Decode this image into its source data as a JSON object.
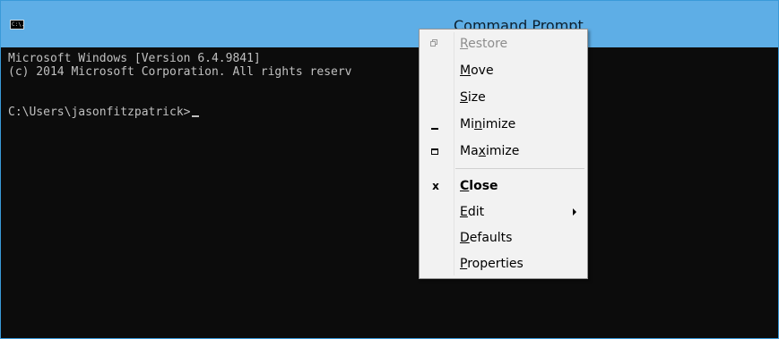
{
  "window": {
    "title": "Command Prompt",
    "icon": "console-app-icon",
    "icon_text": "C:\\."
  },
  "console": {
    "lines": [
      "Microsoft Windows [Version 6.4.9841]",
      "(c) 2014 Microsoft Corporation. All rights reserv",
      "",
      "C:\\Users\\jasonfitzpatrick>"
    ]
  },
  "system_menu": {
    "restore": {
      "pre": "",
      "key": "R",
      "post": "estore",
      "disabled": true,
      "icon": "restore-icon"
    },
    "move": {
      "pre": "",
      "key": "M",
      "post": "ove"
    },
    "size": {
      "pre": "",
      "key": "S",
      "post": "ize"
    },
    "minimize": {
      "pre": "Mi",
      "key": "n",
      "post": "imize",
      "icon": "minimize-icon"
    },
    "maximize": {
      "pre": "Ma",
      "key": "x",
      "post": "imize",
      "icon": "maximize-icon"
    },
    "close": {
      "pre": "",
      "key": "C",
      "post": "lose",
      "icon": "close-icon",
      "icon_glyph": "x"
    },
    "edit": {
      "pre": "",
      "key": "E",
      "post": "dit",
      "has_submenu": true
    },
    "defaults": {
      "pre": "",
      "key": "D",
      "post": "efaults"
    },
    "properties": {
      "pre": "",
      "key": "P",
      "post": "roperties"
    }
  },
  "colors": {
    "titlebar": "#5eaee6",
    "console_bg": "#0c0c0c",
    "console_text": "#c0c0c0",
    "menu_bg": "#f2f2f2"
  }
}
